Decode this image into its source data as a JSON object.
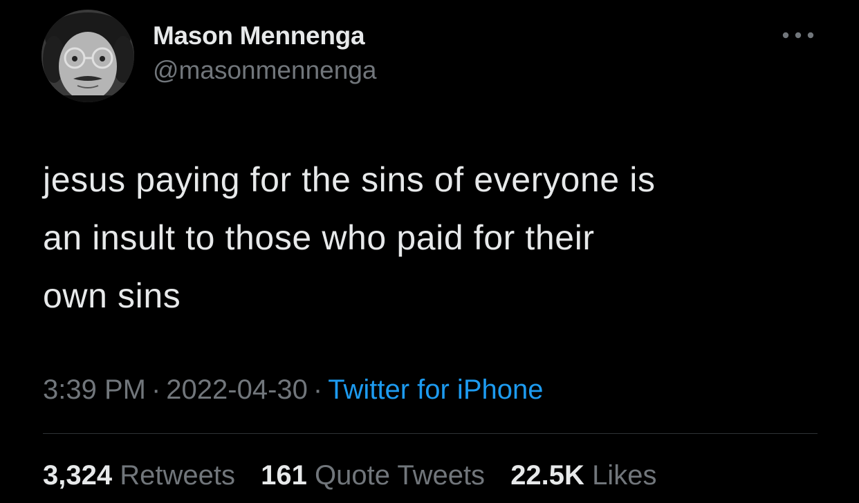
{
  "author": {
    "display_name": "Mason Mennenga",
    "handle": "@masonmennenga"
  },
  "tweet": {
    "text": "jesus paying for the sins of everyone is\nan insult to those who paid for their\nown sins",
    "time": "3:39 PM",
    "date": "2022-04-30",
    "separator": "·",
    "source": "Twitter for iPhone"
  },
  "stats": {
    "retweets_count": "3,324",
    "retweets_label": "Retweets",
    "quotes_count": "161",
    "quotes_label": "Quote Tweets",
    "likes_count": "22.5K",
    "likes_label": "Likes"
  },
  "icons": {
    "more": "more-horizontal-icon",
    "avatar": "profile-photo"
  },
  "colors": {
    "background": "#000000",
    "primary_text": "#e7e9ea",
    "secondary_text": "#71767b",
    "link": "#1d9bf0",
    "divider": "#2f3336"
  }
}
